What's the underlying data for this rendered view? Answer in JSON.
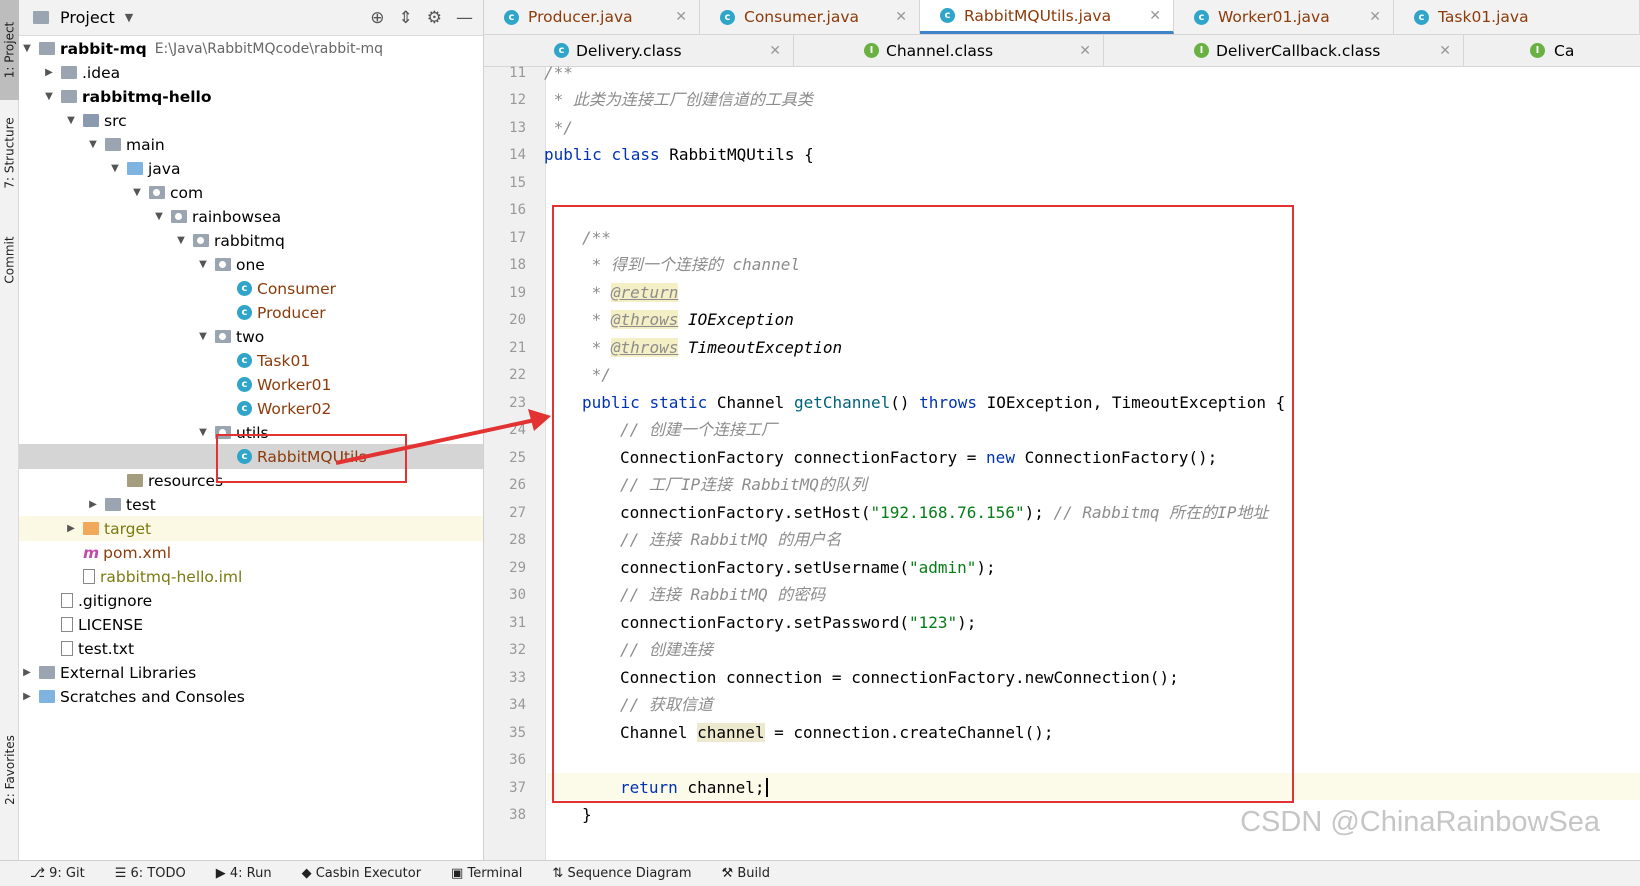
{
  "left_strip": {
    "project_tab": "1: Project",
    "structure_tab": "7: Structure",
    "commit_tab": "Commit",
    "favorites_tab": "2: Favorites"
  },
  "project_panel": {
    "title": "Project",
    "tree": [
      {
        "label": "rabbit-mq",
        "path": "E:\\Java\\RabbitMQcode\\rabbit-mq"
      },
      {
        "label": ".idea"
      },
      {
        "label": "rabbitmq-hello"
      },
      {
        "label": "src"
      },
      {
        "label": "main"
      },
      {
        "label": "java"
      },
      {
        "label": "com"
      },
      {
        "label": "rainbowsea"
      },
      {
        "label": "rabbitmq"
      },
      {
        "label": "one"
      },
      {
        "label": "Consumer"
      },
      {
        "label": "Producer"
      },
      {
        "label": "two"
      },
      {
        "label": "Task01"
      },
      {
        "label": "Worker01"
      },
      {
        "label": "Worker02"
      },
      {
        "label": "utils"
      },
      {
        "label": "RabbitMQUtils"
      },
      {
        "label": "resources"
      },
      {
        "label": "test"
      },
      {
        "label": "target"
      },
      {
        "label": "pom.xml"
      },
      {
        "label": "rabbitmq-hello.iml"
      },
      {
        "label": ".gitignore"
      },
      {
        "label": "LICENSE"
      },
      {
        "label": "test.txt"
      },
      {
        "label": "External Libraries"
      },
      {
        "label": "Scratches and Consoles"
      }
    ]
  },
  "tabs_row1": [
    "Producer.java",
    "Consumer.java",
    "RabbitMQUtils.java",
    "Worker01.java",
    "Task01.java"
  ],
  "tabs_row2": [
    "Delivery.class",
    "Channel.class",
    "DeliverCallback.class",
    "Ca"
  ],
  "line_numbers": [
    "11",
    "12",
    "13",
    "14",
    "15",
    "16",
    "17",
    "18",
    "19",
    "20",
    "21",
    "22",
    "23",
    "24",
    "25",
    "26",
    "27",
    "28",
    "29",
    "30",
    "31",
    "32",
    "33",
    "34",
    "35",
    "36",
    "37",
    "38"
  ],
  "code": {
    "l11": "/**",
    "l12": " * 此类为连接工厂创建信道的工具类",
    "l13": " */",
    "l14_kw1": "public",
    "l14_kw2": "class",
    "l14_rest": " RabbitMQUtils {",
    "l17": "/**",
    "l18": " * 得到一个连接的 channel",
    "l19_a": " * ",
    "l19_tag": "@return",
    "l20_a": " * ",
    "l20_tag": "@throws",
    "l20_b": " IOException",
    "l21_a": " * ",
    "l21_tag": "@throws",
    "l21_b": " TimeoutException",
    "l22": " */",
    "l23_kw1": "public",
    "l23_kw2": "static",
    "l23_type": " Channel ",
    "l23_fn": "getChannel",
    "l23_paren": "() ",
    "l23_kw3": "throws",
    "l23_rest": " IOException, TimeoutException {",
    "l24": "// 创建一个连接工厂",
    "l25_a": "ConnectionFactory connectionFactory = ",
    "l25_kw": "new",
    "l25_b": " ConnectionFactory();",
    "l26": "// 工厂IP连接 RabbitMQ的队列",
    "l27_a": "connectionFactory.setHost(",
    "l27_str": "\"192.168.76.156\"",
    "l27_b": "); ",
    "l27_cm": "// Rabbitmq 所在的IP地址",
    "l28": "// 连接 RabbitMQ 的用户名",
    "l29_a": "connectionFactory.setUsername(",
    "l29_str": "\"admin\"",
    "l29_b": ");",
    "l30": "// 连接 RabbitMQ 的密码",
    "l31_a": "connectionFactory.setPassword(",
    "l31_str": "\"123\"",
    "l31_b": ");",
    "l32": "// 创建连接",
    "l33": "Connection connection = connectionFactory.newConnection();",
    "l34": "// 获取信道",
    "l35_a": "Channel ",
    "l35_var": "channel",
    "l35_b": " = connection.createChannel();",
    "l37_kw": "return",
    "l37_b": " channel;",
    "l38": "}"
  },
  "status_bar": [
    "9: Git",
    "6: TODO",
    "4: Run",
    "Casbin Executor",
    "Terminal",
    "Sequence Diagram",
    "Build"
  ],
  "watermark": "CSDN @ChinaRainbowSea",
  "colors": {
    "annotation_red": "#e23232",
    "keyword": "#0033b3",
    "string": "#067d17",
    "comment": "#8c8c8c"
  }
}
